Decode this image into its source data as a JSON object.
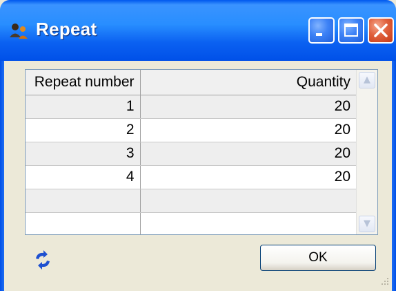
{
  "window": {
    "title": "Repeat"
  },
  "grid": {
    "headers": [
      "Repeat number",
      "Quantity"
    ],
    "rows": [
      {
        "repeat_number": "1",
        "quantity": "20"
      },
      {
        "repeat_number": "2",
        "quantity": "20"
      },
      {
        "repeat_number": "3",
        "quantity": "20"
      },
      {
        "repeat_number": "4",
        "quantity": "20"
      },
      {
        "repeat_number": "",
        "quantity": ""
      },
      {
        "repeat_number": "",
        "quantity": ""
      }
    ]
  },
  "footer": {
    "ok_label": "OK"
  },
  "icons": {
    "title": "users-icon",
    "refresh": "refresh-icon"
  },
  "colors": {
    "titlebar": "#0B61F1",
    "dialog_bg": "#ECE9D8",
    "grid_border": "#7F9DB9",
    "alt_row": "#EEEEEE"
  }
}
